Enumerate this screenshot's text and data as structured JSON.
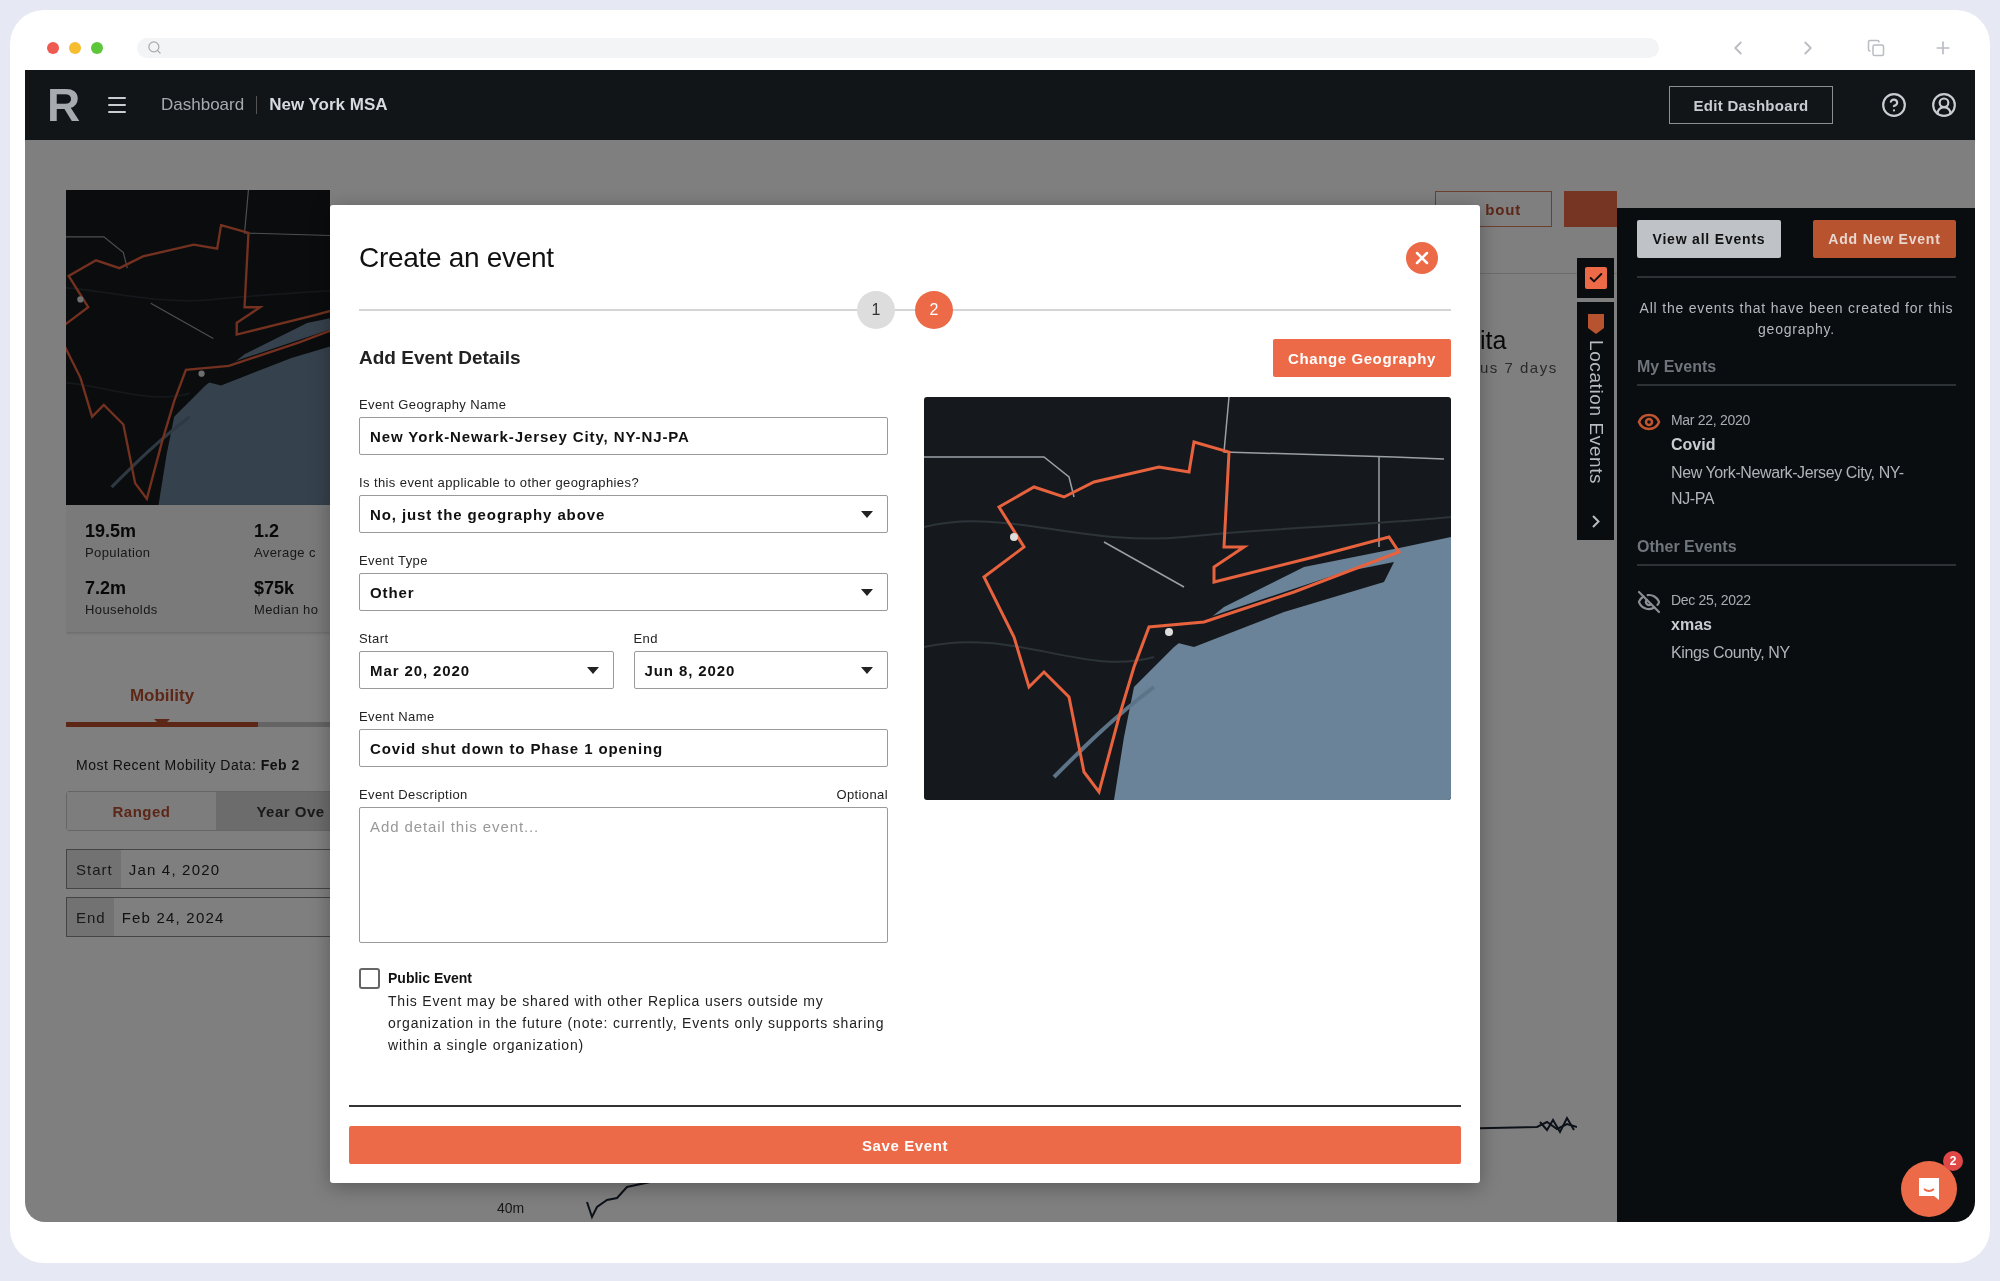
{
  "header": {
    "logo": "R",
    "breadcrumbs": [
      "Dashboard",
      "New York MSA"
    ],
    "edit_button": "Edit Dashboard"
  },
  "background": {
    "stats": [
      {
        "value": "19.5m",
        "label": "Population"
      },
      {
        "value": "1.2",
        "label": "Average c"
      },
      {
        "value": "7.2m",
        "label": "Households"
      },
      {
        "value": "$75k",
        "label": "Median ho"
      }
    ],
    "tabs": [
      {
        "label": "Mobility",
        "selected": true
      }
    ],
    "recent_data": "Most Recent Mobility Data: **Feb 2**",
    "range_toggle": [
      {
        "label": "Ranged",
        "selected": true
      },
      {
        "label": "Year Ove",
        "selected": false
      }
    ],
    "date_fields": [
      {
        "label": "Start",
        "value": "Jan 4, 2020"
      },
      {
        "label": "End",
        "value": "Feb 24, 2024"
      }
    ],
    "about_button": "bout",
    "metric_title": "ita",
    "metric_subtitle": "us 7 days",
    "chart_axis_label": "40m"
  },
  "side_tab": {
    "label": "Location Events",
    "checked": true
  },
  "events_panel": {
    "view_button": "View all Events",
    "add_button": "Add New Event",
    "description": "All the events that have been created for this geography.",
    "sections": [
      {
        "title": "My Events",
        "events": [
          {
            "date": "Mar 22, 2020",
            "name": "Covid",
            "geography": "New York-Newark-Jersey City, NY-NJ-PA",
            "visible": true
          }
        ]
      },
      {
        "title": "Other Events",
        "events": [
          {
            "date": "Dec 25, 2022",
            "name": "xmas",
            "geography": "Kings County, NY",
            "visible": false
          }
        ]
      }
    ]
  },
  "modal": {
    "title": "Create an event",
    "steps": [
      {
        "label": "1",
        "selected": false
      },
      {
        "label": "2",
        "selected": true
      }
    ],
    "section_title": "Add Event Details",
    "change_geography_button": "Change Geography",
    "fields": [
      {
        "kind": "input",
        "label": "Event Geography Name",
        "value": "New York-Newark-Jersey City, NY-NJ-PA"
      },
      {
        "kind": "select",
        "label": "Is this event applicable to other geographies?",
        "value": "No, just the geography above"
      },
      {
        "kind": "select",
        "label": "Event Type",
        "value": "Other"
      },
      {
        "kind": "pair",
        "items": [
          {
            "kind": "select",
            "label": "Start",
            "value": "Mar 20, 2020"
          },
          {
            "kind": "select",
            "label": "End",
            "value": "Jun 8, 2020"
          }
        ]
      },
      {
        "kind": "input",
        "label": "Event Name",
        "value": "Covid shut down to Phase 1 opening"
      },
      {
        "kind": "textarea",
        "label": "Event Description",
        "note": "Optional",
        "placeholder": "Add detail this event..."
      }
    ],
    "public_event": {
      "label": "Public Event",
      "checked": false,
      "description": "This Event may be shared with other Replica users outside my organization in the future (note: currently, Events only supports sharing within a single organization)"
    },
    "save_button": "Save Event"
  },
  "chat": {
    "badge": "2"
  }
}
